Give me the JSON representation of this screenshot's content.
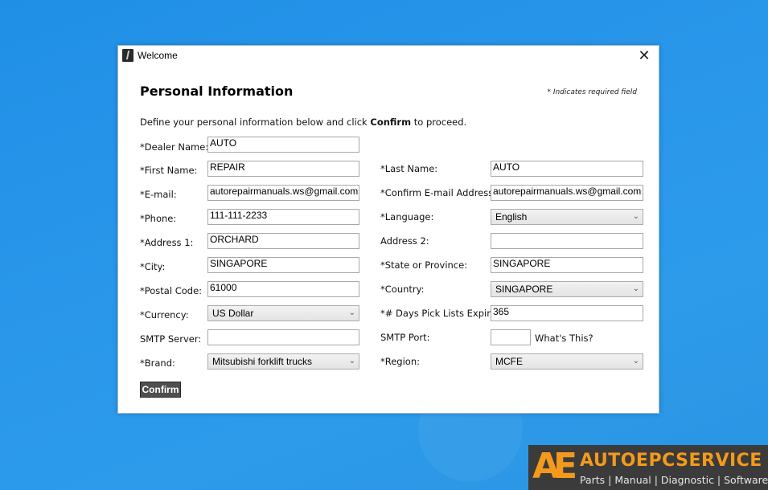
{
  "window": {
    "title": "Welcome",
    "close_symbol": "✕"
  },
  "form": {
    "heading": "Personal Information",
    "required_note": "* Indicates required field",
    "intro_before": "Define your personal information below and click ",
    "intro_bold": "Confirm",
    "intro_after": " to proceed.",
    "dealer_name": {
      "label": "*Dealer Name:",
      "value": "AUTO"
    },
    "first_name": {
      "label": "*First Name:",
      "value": "REPAIR"
    },
    "last_name": {
      "label": "*Last Name:",
      "value": "AUTO"
    },
    "email": {
      "label": "*E-mail:",
      "value": "autorepairmanuals.ws@gmail.com"
    },
    "confirm_email": {
      "label": "*Confirm E-mail Address:",
      "value": "autorepairmanuals.ws@gmail.com"
    },
    "phone": {
      "label": "*Phone:",
      "value": "111-111-2233"
    },
    "language": {
      "label": "*Language:",
      "value": "English"
    },
    "address1": {
      "label": "*Address 1:",
      "value": "ORCHARD"
    },
    "address2": {
      "label": "Address 2:",
      "value": ""
    },
    "city": {
      "label": "*City:",
      "value": "SINGAPORE"
    },
    "state": {
      "label": "*State or Province:",
      "value": "SINGAPORE"
    },
    "postal_code": {
      "label": "*Postal Code:",
      "value": "61000"
    },
    "country": {
      "label": "*Country:",
      "value": "SINGAPORE"
    },
    "currency": {
      "label": "*Currency:",
      "value": "US Dollar"
    },
    "pick_days": {
      "label": "*# Days Pick Lists Expire:",
      "value": "365"
    },
    "smtp_server": {
      "label": "SMTP Server:",
      "value": ""
    },
    "smtp_port": {
      "label": "SMTP Port:",
      "value": "",
      "help": "What's This?"
    },
    "brand": {
      "label": "*Brand:",
      "value": "Mitsubishi forklift trucks"
    },
    "region": {
      "label": "*Region:",
      "value": "MCFE"
    },
    "confirm_label": "Confirm",
    "dropdown_icon": "chevron-down-icon",
    "chevron_glyph": "⌄"
  },
  "watermark": {
    "logo_text": "AE",
    "brand": "AUTOEPCSERVICE",
    "tagline": "Parts | Manual | Diagnostic | Software"
  }
}
